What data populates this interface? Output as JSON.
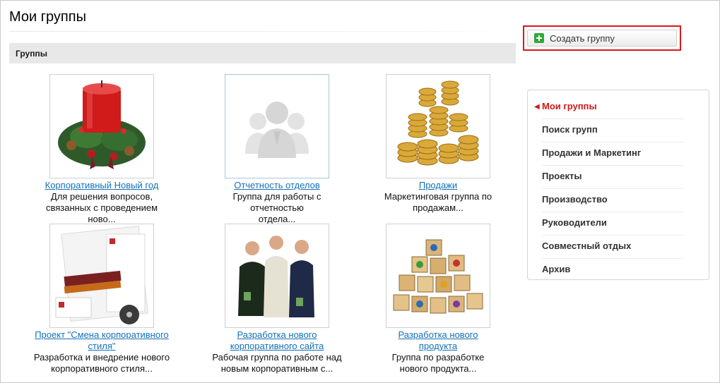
{
  "page": {
    "title": "Мои группы"
  },
  "create_button": {
    "label": "Создать группу",
    "icon": "plus-icon"
  },
  "section": {
    "label": "Группы"
  },
  "groups": [
    {
      "name": "Корпоративный Новый год",
      "desc_line1": "Для решения вопросов,",
      "desc_line2": "связанных с проведением ново...",
      "image": "christmas-candle-image"
    },
    {
      "name": "Отчетность отделов",
      "desc_line1": "Группа для работы с отчетностью",
      "desc_line2": "отдела...",
      "image": "default-group-avatar"
    },
    {
      "name": "Продажи",
      "desc_line1": "Маркетинговая группа по",
      "desc_line2": "продажам...",
      "image": "gold-coins-image"
    },
    {
      "name_line1": "Проект \"Смена корпоративного",
      "name_line2": "стиля\"",
      "desc_line1": "Разработка и внедрение нового",
      "desc_line2": "корпоративного стиля...",
      "image": "brochures-image"
    },
    {
      "name_line1": "Разработка нового",
      "name_line2": "корпоративного сайта",
      "desc_line1": "Рабочая группа по работе над",
      "desc_line2": "новым корпоративным с...",
      "image": "three-men-image"
    },
    {
      "name_line1": "Разработка нового",
      "name_line2": "продукта",
      "desc_line1": "Группа по разработке",
      "desc_line2": "нового продукта...",
      "image": "toy-blocks-image"
    }
  ],
  "menu": {
    "items": [
      {
        "label": "Мои группы",
        "active": true
      },
      {
        "label": "Поиск групп"
      },
      {
        "label": "Продажи и Маркетинг"
      },
      {
        "label": "Проекты"
      },
      {
        "label": "Производство"
      },
      {
        "label": "Руководители"
      },
      {
        "label": "Совместный отдых"
      },
      {
        "label": "Архив"
      }
    ]
  },
  "colors": {
    "accent_red": "#d9191f",
    "link_blue": "#1470b8",
    "menu_active": "#cc1a1a",
    "plus_green": "#2fa83a"
  }
}
